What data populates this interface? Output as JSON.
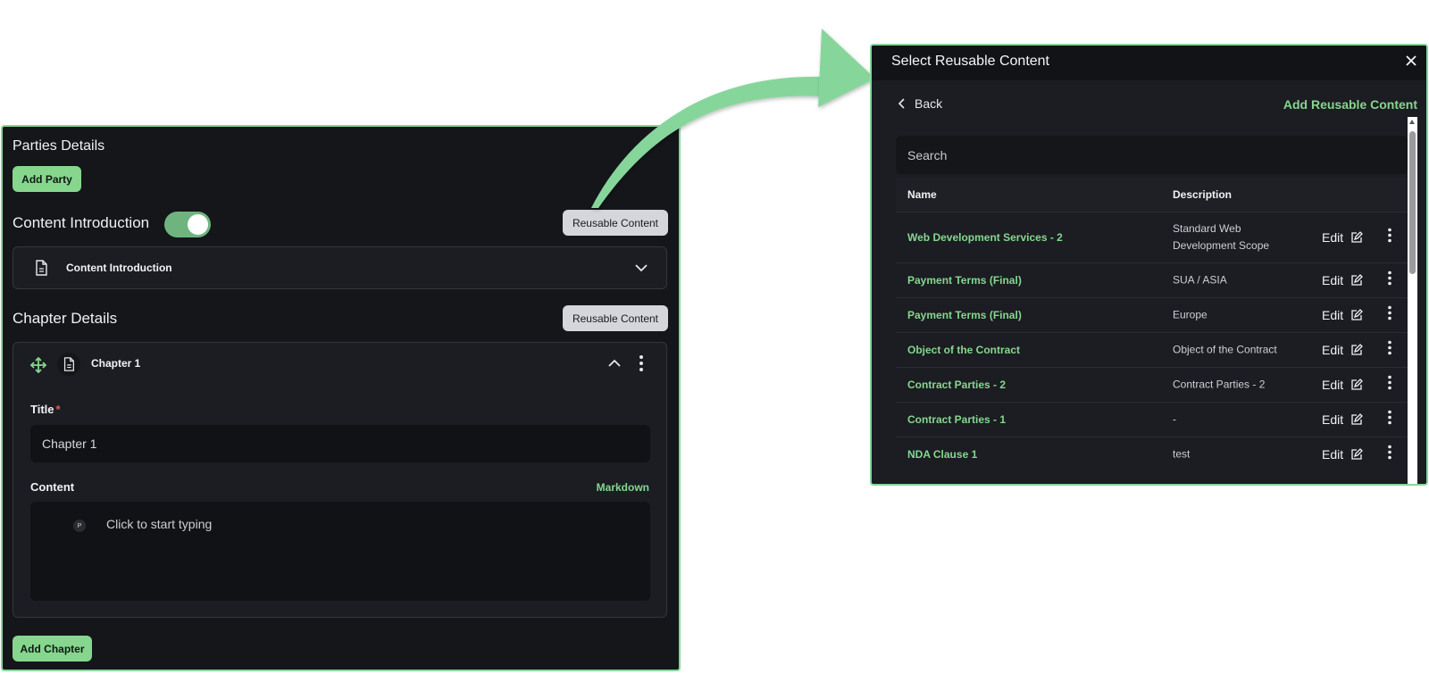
{
  "left": {
    "parties_title": "Parties Details",
    "add_party": "Add Party",
    "content_intro_title": "Content Introduction",
    "toggle_on": true,
    "reusable_content_btn": "Reusable Content",
    "accordion_label": "Content Introduction",
    "chapter_details_title": "Chapter Details",
    "chapter_label": "Chapter 1",
    "title_label": "Title",
    "required_mark": "*",
    "title_value": "Chapter 1",
    "content_label": "Content",
    "markdown_link": "Markdown",
    "paragraph_badge": "P",
    "editor_placeholder": "Click to start typing",
    "add_chapter": "Add Chapter"
  },
  "modal": {
    "title": "Select Reusable Content",
    "back": "Back",
    "add_reusable": "Add Reusable Content",
    "search_placeholder": "Search",
    "columns": {
      "name": "Name",
      "description": "Description"
    },
    "edit_label": "Edit",
    "rows": [
      {
        "name": "Web Development Services - 2",
        "description": "Standard Web Development Scope"
      },
      {
        "name": "Payment Terms (Final)",
        "description": "SUA / ASIA"
      },
      {
        "name": "Payment Terms (Final)",
        "description": "Europe"
      },
      {
        "name": "Object of the Contract",
        "description": "Object of the Contract"
      },
      {
        "name": "Contract Parties - 2",
        "description": "Contract Parties - 2"
      },
      {
        "name": "Contract Parties - 1",
        "description": "-"
      },
      {
        "name": "NDA Clause 1",
        "description": "test"
      }
    ]
  },
  "colors": {
    "accent_green": "#86d68e",
    "panel_bg": "#14161a",
    "border_green": "#86d69c"
  }
}
